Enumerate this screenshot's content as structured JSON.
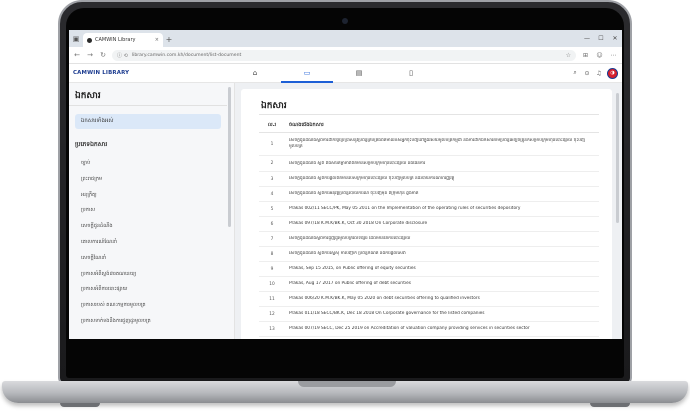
{
  "browser": {
    "tab_title": "CAMWIN Library",
    "tab_close": "×",
    "new_tab": "+",
    "window_menu_icon": "▣",
    "window_controls": [
      "—",
      "☐",
      "✕"
    ],
    "url_icons": "ⓘ ⟲",
    "url": "library.camwin.com.kh/document/list-document",
    "nav": {
      "back": "←",
      "forward": "→",
      "reload": "↻"
    },
    "tools": [
      "⌕",
      "☆",
      "⊞",
      "☺",
      "⋯"
    ]
  },
  "site": {
    "logo": "CAMWIN LIBRARY",
    "nav_tabs": [
      {
        "icon": "home-icon",
        "glyph": "⌂"
      },
      {
        "icon": "book-icon",
        "glyph": "▭"
      },
      {
        "icon": "calendar-icon",
        "glyph": "▤"
      },
      {
        "icon": "document-icon",
        "glyph": "▯"
      }
    ],
    "header_tools": {
      "search": "⌕",
      "location": "⊙",
      "bell": "♫",
      "avatar": "◑"
    }
  },
  "sidebar": {
    "title": "ឯកសារ",
    "active_item": "ឯកសារទាំងអស់",
    "section_heading": "ប្រភេទឯកសារ",
    "items": [
      "ច្បាប់",
      "ព្រះរាជក្រម",
      "អនុក្រឹត្យ",
      "ប្រកាស",
      "សេចក្ដីជូនដំណឹង",
      "គោលការណ៍ណែនាំ",
      "សេចក្ដីណែនាំ",
      "ប្រកាសអំពីស្ដង់ដារគណនេយ្យ",
      "ប្រកាសអំពីការបោះផ្សាយ",
      "ប្រកាសរបស់ គណៈកម្មការមូលបត្រ",
      "ប្រកាសទាក់ទងនឹងការជួញដូរមូលបត្រ"
    ]
  },
  "content": {
    "title": "ឯកសារ",
    "columns": {
      "no": "ល.រ",
      "description": "ចំណងជើងឯកសារ"
    },
    "rows": [
      {
        "no": "1",
        "text": "សេចក្ដីជូនដំណឹងស្ដីពីការដាក់ឱ្យប្រើប្រាស់នូវប្រព័ន្ធគ្រប់គ្រងព័ត៌មានរបស់អ្នកចុះបញ្ជីនៅក្នុងវិស័យមូលបត្រកម្ពុជា និងការដាក់ឯកសារតាមប្រព័ន្ធអេឡិចត្រូនិកសម្រាប់ក្រុមហ៊ុនបោះផ្សាយ ចុះបញ្ជីមូលបត្រ"
      },
      {
        "no": "2",
        "text": "សេចក្ដីជូនដំណឹង ស្ដីពី ពិធីសារតម្លាភាពព័ត៌មានសម្រាប់ក្រុមហ៊ុនបោះផ្សាយ និងផែនការ"
      },
      {
        "no": "3",
        "text": "សេចក្ដីជូនដំណឹង ស្ដីពីការផ្ដល់ព័ត៌មានរបស់ក្រុមហ៊ុនបោះផ្សាយ ចុះបញ្ជីមូលបត្រ និងរបាយការណ៍ហិរញ្ញវត្ថុ"
      },
      {
        "no": "4",
        "text": "សេចក្ដីជូនដំណឹង ស្ដីពីការអនុវត្តប្រព័ន្ធរបាយការណ៍ ចុះបញ្ជីមុន ពីក្រុមហ៊ុន ឆ្លងកាត់"
      },
      {
        "no": "5",
        "text": "Prakas 002/11 SECC/PK, May 05 2011 on the Implementation of the operating rules of securities depository"
      },
      {
        "no": "6",
        "text": "Prakas 097/18 K.M.K/BK.K, Oct 30 2018 On Corporate disclosure"
      },
      {
        "no": "7",
        "text": "សេចក្ដីជូនដំណឹងស្ដីពីការជួញដូរមូលបត្រលើទីផ្សារ ដែលមានតែការបោះផ្សាយ"
      },
      {
        "no": "8",
        "text": "សេចក្ដីជូនដំណឹង ស្ដីពីការស្នើសុំ ការបញ្ជាក់ ប្រព័ន្ធកំណត់ និងការផ្ដល់សេវា"
      },
      {
        "no": "9",
        "text": "Prakas, Sep 15 2015, on Public offering of equity securities"
      },
      {
        "no": "10",
        "text": "Prakas, Aug 17 2017 on Public offering of debt securities"
      },
      {
        "no": "11",
        "text": "Prakas 006/20 K.M.K/BK.K, May 05 2020 on debt securities offering to qualified investors"
      },
      {
        "no": "12",
        "text": "Prakas 011/18 SECC/BK.K, Dec 18 2018 On Corporate governance for the listed companies"
      },
      {
        "no": "13",
        "text": "Prakas 007/19 SECC, Dec 25 2019 on Accreditation of valuation company providing services in securities sector"
      }
    ]
  }
}
